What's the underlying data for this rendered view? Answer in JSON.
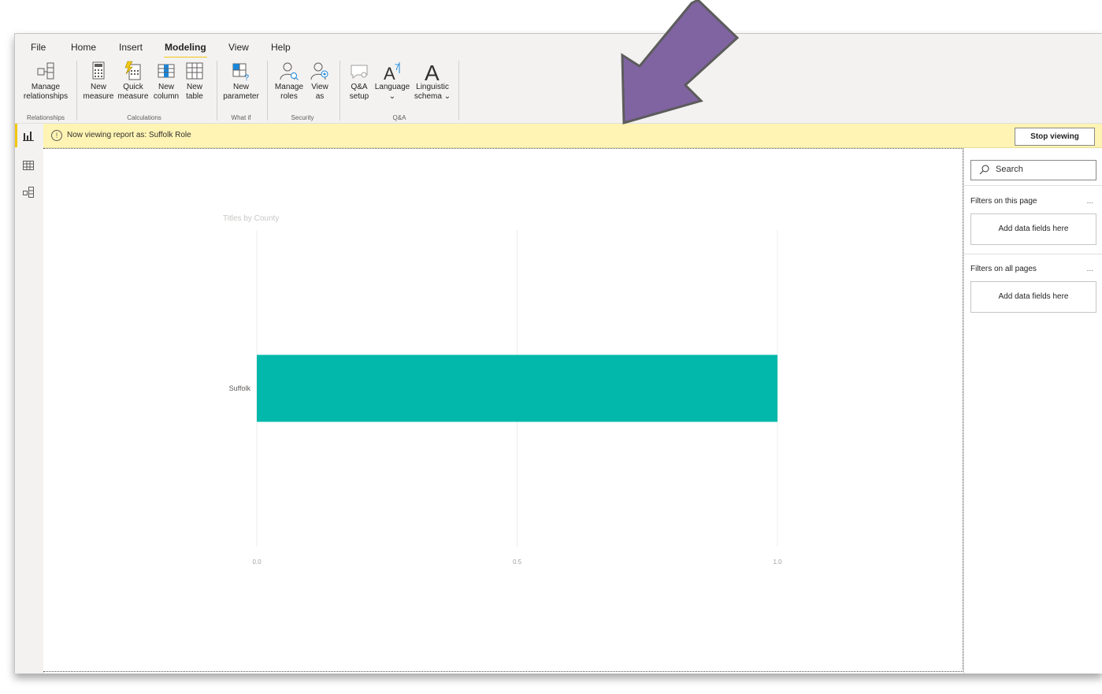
{
  "ribbon": {
    "tabs": [
      "File",
      "Home",
      "Insert",
      "Modeling",
      "View",
      "Help"
    ],
    "active_tab": "Modeling",
    "buttons": {
      "manage_relationships": [
        "Manage",
        "relationships"
      ],
      "new_measure": [
        "New",
        "measure"
      ],
      "quick_measure": [
        "Quick",
        "measure"
      ],
      "new_column": [
        "New",
        "column"
      ],
      "new_table": [
        "New",
        "table"
      ],
      "new_parameter": [
        "New",
        "parameter"
      ],
      "manage_roles": [
        "Manage",
        "roles"
      ],
      "view_as": [
        "View",
        "as"
      ],
      "qa_setup": [
        "Q&A",
        "setup"
      ],
      "language": [
        "Language",
        "⌄"
      ],
      "linguistic_schema": [
        "Linguistic",
        "schema ⌄"
      ]
    },
    "groups": {
      "relationships": "Relationships",
      "calculations": "Calculations",
      "whatif": "What if",
      "security": "Security",
      "qa": "Q&A"
    }
  },
  "rolebar": {
    "message": "Now viewing report as: Suffolk Role",
    "stop_button": "Stop viewing",
    "warn_glyph": "!"
  },
  "rail": {
    "icons": [
      "report-view-icon",
      "data-view-icon",
      "model-view-icon"
    ]
  },
  "filters": {
    "search_placeholder": "Search",
    "page_header": "Filters on this page",
    "all_header": "Filters on all pages",
    "more": "...",
    "dropzone_text": "Add data fields here"
  },
  "colors": {
    "accent": "#f2c811",
    "bar": "#01b8aa",
    "arrow": "#8064a2"
  },
  "chart_data": {
    "type": "bar",
    "orientation": "horizontal",
    "title": "Titles by County",
    "categories": [
      "Suffolk"
    ],
    "values": [
      1.0
    ],
    "xlim": [
      0,
      1.0
    ],
    "xticks": [
      "0.0",
      "0.5",
      "1.0"
    ],
    "grid": true
  }
}
